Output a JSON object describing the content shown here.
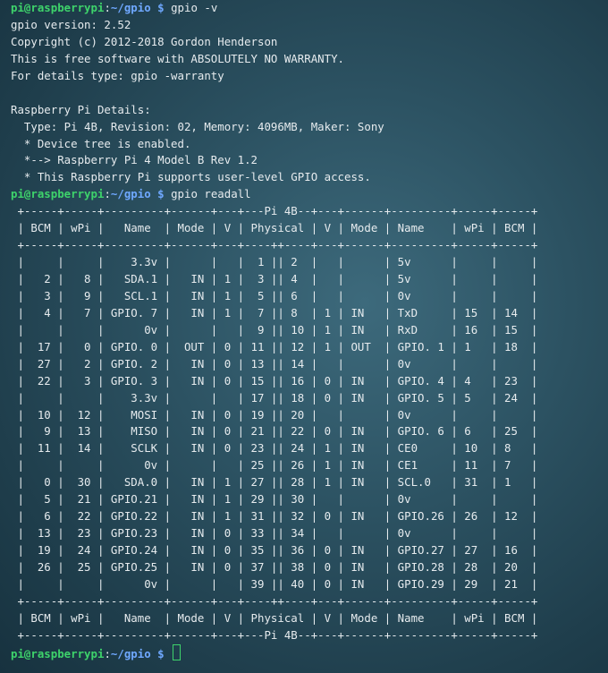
{
  "prompt": {
    "user": "pi@raspberrypi",
    "sep": ":",
    "path": "~/gpio",
    "sym": " $ "
  },
  "commands": {
    "version": "gpio -v",
    "readall": "gpio readall"
  },
  "version_output": [
    "gpio version: 2.52",
    "Copyright (c) 2012-2018 Gordon Henderson",
    "This is free software with ABSOLUTELY NO WARRANTY.",
    "For details type: gpio -warranty",
    "",
    "Raspberry Pi Details:",
    "  Type: Pi 4B, Revision: 02, Memory: 4096MB, Maker: Sony",
    "  * Device tree is enabled.",
    "  *--> Raspberry Pi 4 Model B Rev 1.2",
    "  * This Raspberry Pi supports user-level GPIO access."
  ],
  "readall_output": [
    " +-----+-----+---------+------+---+---Pi 4B--+---+------+---------+-----+-----+",
    " | BCM | wPi |   Name  | Mode | V | Physical | V | Mode | Name    | wPi | BCM |",
    " +-----+-----+---------+------+---+----++----+---+------+---------+-----+-----+",
    " |     |     |    3.3v |      |   |  1 || 2  |   |      | 5v      |     |     |",
    " |   2 |   8 |   SDA.1 |   IN | 1 |  3 || 4  |   |      | 5v      |     |     |",
    " |   3 |   9 |   SCL.1 |   IN | 1 |  5 || 6  |   |      | 0v      |     |     |",
    " |   4 |   7 | GPIO. 7 |   IN | 1 |  7 || 8  | 1 | IN   | TxD     | 15  | 14  |",
    " |     |     |      0v |      |   |  9 || 10 | 1 | IN   | RxD     | 16  | 15  |",
    " |  17 |   0 | GPIO. 0 |  OUT | 0 | 11 || 12 | 1 | OUT  | GPIO. 1 | 1   | 18  |",
    " |  27 |   2 | GPIO. 2 |   IN | 0 | 13 || 14 |   |      | 0v      |     |     |",
    " |  22 |   3 | GPIO. 3 |   IN | 0 | 15 || 16 | 0 | IN   | GPIO. 4 | 4   | 23  |",
    " |     |     |    3.3v |      |   | 17 || 18 | 0 | IN   | GPIO. 5 | 5   | 24  |",
    " |  10 |  12 |    MOSI |   IN | 0 | 19 || 20 |   |      | 0v      |     |     |",
    " |   9 |  13 |    MISO |   IN | 0 | 21 || 22 | 0 | IN   | GPIO. 6 | 6   | 25  |",
    " |  11 |  14 |    SCLK |   IN | 0 | 23 || 24 | 1 | IN   | CE0     | 10  | 8   |",
    " |     |     |      0v |      |   | 25 || 26 | 1 | IN   | CE1     | 11  | 7   |",
    " |   0 |  30 |   SDA.0 |   IN | 1 | 27 || 28 | 1 | IN   | SCL.0   | 31  | 1   |",
    " |   5 |  21 | GPIO.21 |   IN | 1 | 29 || 30 |   |      | 0v      |     |     |",
    " |   6 |  22 | GPIO.22 |   IN | 1 | 31 || 32 | 0 | IN   | GPIO.26 | 26  | 12  |",
    " |  13 |  23 | GPIO.23 |   IN | 0 | 33 || 34 |   |      | 0v      |     |     |",
    " |  19 |  24 | GPIO.24 |   IN | 0 | 35 || 36 | 0 | IN   | GPIO.27 | 27  | 16  |",
    " |  26 |  25 | GPIO.25 |   IN | 0 | 37 || 38 | 0 | IN   | GPIO.28 | 28  | 20  |",
    " |     |     |      0v |      |   | 39 || 40 | 0 | IN   | GPIO.29 | 29  | 21  |",
    " +-----+-----+---------+------+---+----++----+---+------+---------+-----+-----+",
    " | BCM | wPi |   Name  | Mode | V | Physical | V | Mode | Name    | wPi | BCM |",
    " +-----+-----+---------+------+---+---Pi 4B--+---+------+---------+-----+-----+"
  ]
}
